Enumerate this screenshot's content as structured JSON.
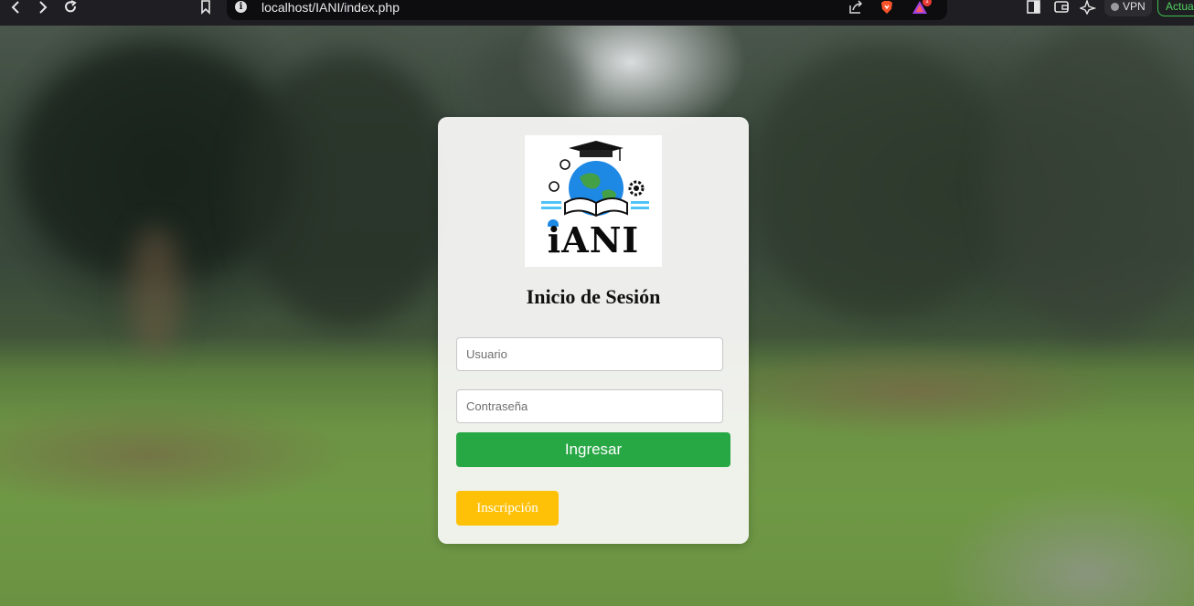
{
  "browser": {
    "url": "localhost/IANI/index.php",
    "rewards_badge": "1",
    "vpn_label": "VPN",
    "update_label": "Actualizar"
  },
  "login": {
    "logo_text": "iANI",
    "title": "Inicio de Sesión",
    "username_placeholder": "Usuario",
    "password_placeholder": "Contraseña",
    "login_button": "Ingresar",
    "signup_button": "Inscripción"
  },
  "colors": {
    "login_button": "#28a745",
    "signup_button": "#ffc107",
    "update_accent": "#4fd05f"
  }
}
